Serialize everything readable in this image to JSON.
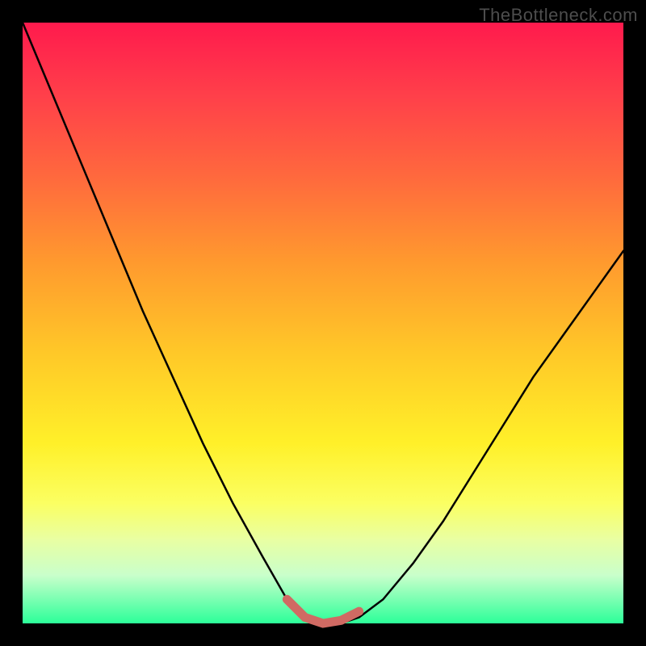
{
  "watermark": "TheBottleneck.com",
  "colors": {
    "frame": "#000000",
    "gradient_top": "#ff1a4d",
    "gradient_bottom": "#2cff99",
    "curve": "#000000",
    "valley_highlight": "#d06a63"
  },
  "chart_data": {
    "type": "line",
    "title": "",
    "xlabel": "",
    "ylabel": "",
    "xlim": [
      0,
      100
    ],
    "ylim": [
      0,
      100
    ],
    "series": [
      {
        "name": "bottleneck-curve",
        "x": [
          0,
          5,
          10,
          15,
          20,
          25,
          30,
          35,
          40,
          44,
          47,
          50,
          53,
          56,
          60,
          65,
          70,
          75,
          80,
          85,
          90,
          95,
          100
        ],
        "y": [
          100,
          88,
          76,
          64,
          52,
          41,
          30,
          20,
          11,
          4,
          1,
          0,
          0,
          1,
          4,
          10,
          17,
          25,
          33,
          41,
          48,
          55,
          62
        ]
      }
    ],
    "valley_segment": {
      "name": "valley-highlight",
      "x": [
        44,
        47,
        50,
        53,
        56
      ],
      "y": [
        4,
        1,
        0,
        0.5,
        2
      ]
    }
  }
}
